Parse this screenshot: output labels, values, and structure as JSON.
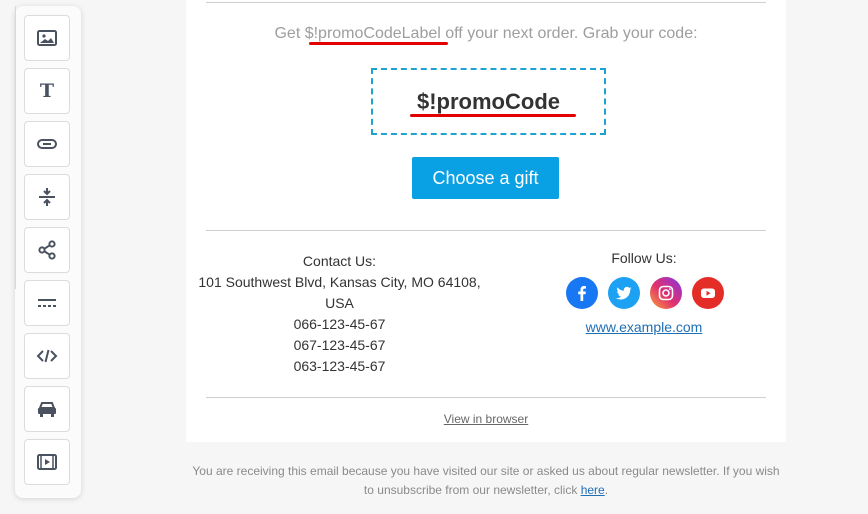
{
  "tools": [
    {
      "icon": "image-block-icon"
    },
    {
      "icon": "text-block-icon",
      "glyph": "T"
    },
    {
      "icon": "button-block-icon"
    },
    {
      "icon": "spacer-block-icon"
    },
    {
      "icon": "social-block-icon"
    },
    {
      "icon": "divider-block-icon"
    },
    {
      "icon": "html-code-block-icon"
    },
    {
      "icon": "banner-block-icon"
    },
    {
      "icon": "video-block-icon"
    }
  ],
  "email": {
    "promo_prefix": "Get ",
    "promo_label": "$!promoCodeLabel",
    "promo_suffix": " off your next order. Grab your code:",
    "promo_code": "$!promoCode",
    "cta_label": "Choose a gift",
    "contact_title": "Contact Us:",
    "contact_address_1": "101 Southwest Blvd, Kansas City, MO 64108,",
    "contact_address_2": "USA",
    "phones": [
      "066-123-45-67",
      "067-123-45-67",
      "063-123-45-67"
    ],
    "follow_title": "Follow Us:",
    "socials": [
      {
        "icon": "facebook-icon",
        "color": "#1877f2"
      },
      {
        "icon": "twitter-icon",
        "color": "#1da1f2"
      },
      {
        "icon": "instagram-icon",
        "color": "#c13584"
      },
      {
        "icon": "youtube-icon",
        "color": "#e52d27"
      }
    ],
    "website": "www.example.com",
    "view_in_browser": "View in browser"
  },
  "footer": {
    "text_before": "You are receiving this email because you have visited our site or asked us about regular newsletter. If you wish to unsubscribe from our newsletter, click ",
    "link": "here",
    "text_after": "."
  },
  "colors": {
    "accent": "#0aa0e4",
    "code_border": "#1ea3d1",
    "highlight_underline": "#e30000"
  }
}
